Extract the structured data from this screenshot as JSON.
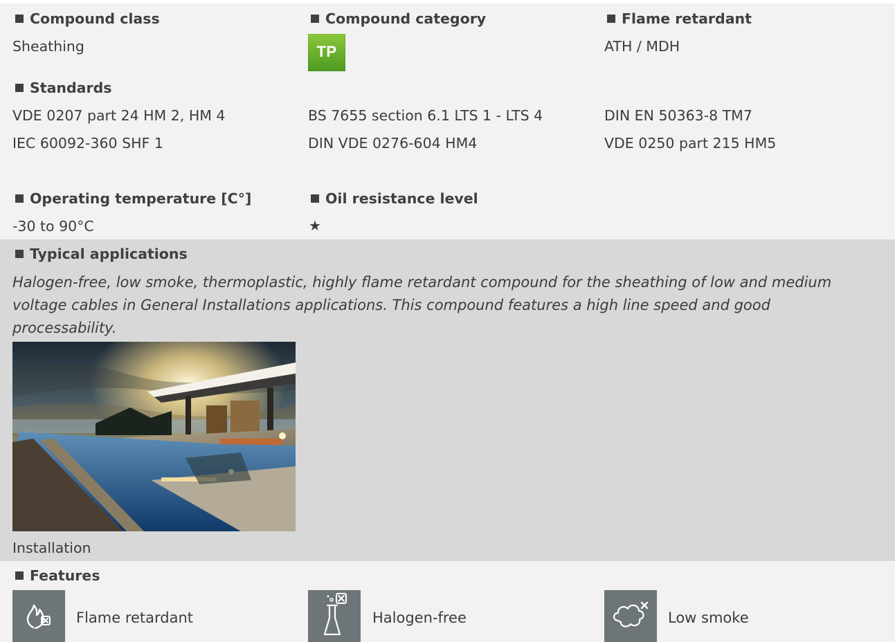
{
  "compound_class": {
    "heading": "Compound class",
    "value": "Sheathing"
  },
  "compound_category": {
    "heading": "Compound category",
    "badge": "TP",
    "badge_color": "#6cb52d"
  },
  "flame_retardant": {
    "heading": "Flame retardant",
    "value": "ATH / MDH"
  },
  "standards": {
    "heading": "Standards",
    "items": [
      "VDE 0207 part 24 HM 2, HM 4",
      "BS 7655 section 6.1 LTS 1 - LTS 4",
      "DIN EN 50363-8 TM7",
      "IEC 60092-360 SHF 1",
      "DIN VDE 0276-604 HM4",
      "VDE 0250 part 215 HM5"
    ]
  },
  "operating_temperature": {
    "heading": "Operating temperature [C°]",
    "value": "-30 to 90°C"
  },
  "oil_resistance": {
    "heading": "Oil resistance level",
    "value": "★"
  },
  "typical_applications": {
    "heading": "Typical applications",
    "description": "Halogen-free, low smoke, thermoplastic, highly flame retardant compound for the sheathing of low and medium voltage cables in General Installations applications. This compound features a high line speed and good processability.",
    "image_caption": "Installation"
  },
  "features": {
    "heading": "Features",
    "items": [
      {
        "label": "Flame retardant",
        "icon": "flame-crossed-icon"
      },
      {
        "label": "Halogen-free",
        "icon": "flask-crossed-icon"
      },
      {
        "label": "Low smoke",
        "icon": "smoke-cloud-crossed-icon"
      }
    ]
  },
  "colors": {
    "panel_bg": "#f2f2f2",
    "applications_bg": "#d8d8d8",
    "feature_icon_bg": "#6d7578",
    "text": "#3c3c3c"
  }
}
